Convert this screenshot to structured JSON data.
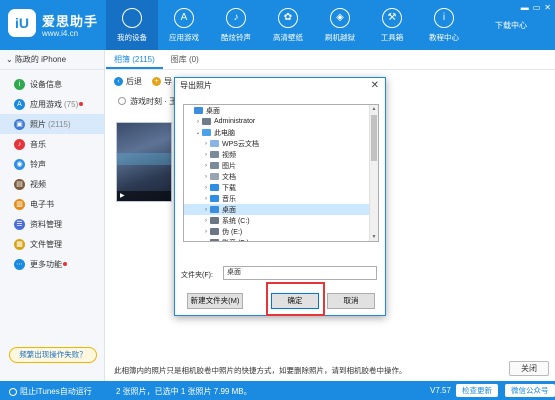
{
  "app": {
    "brand_name": "爱思助手",
    "brand_url": "www.i4.cn",
    "logo_text": "iU",
    "download_center": "下载中心",
    "window_controls": [
      "▬",
      "▭",
      "✕"
    ]
  },
  "nav": [
    {
      "label": "我的设备",
      "icon": "apple-icon",
      "glyph": "",
      "active": true
    },
    {
      "label": "应用游戏",
      "icon": "appstore-icon",
      "glyph": "A",
      "active": false
    },
    {
      "label": "酷炫铃声",
      "icon": "bell-icon",
      "glyph": "♪",
      "active": false
    },
    {
      "label": "高清壁纸",
      "icon": "flower-icon",
      "glyph": "✿",
      "active": false
    },
    {
      "label": "刷机越狱",
      "icon": "box-icon",
      "glyph": "◈",
      "active": false
    },
    {
      "label": "工具箱",
      "icon": "toolbox-icon",
      "glyph": "⚒",
      "active": false
    },
    {
      "label": "教程中心",
      "icon": "info-icon",
      "glyph": "i",
      "active": false
    }
  ],
  "sidebar": {
    "device": "陈政的 iPhone",
    "items": [
      {
        "label": "设备信息",
        "count": "",
        "dot": false,
        "active": false,
        "color": "#2fa84f",
        "glyph": "i"
      },
      {
        "label": "应用游戏",
        "count": "(75)",
        "dot": true,
        "active": false,
        "color": "#1a8be0",
        "glyph": "A"
      },
      {
        "label": "照片",
        "count": "(2115)",
        "dot": false,
        "active": true,
        "color": "#3e7bd6",
        "glyph": "▣"
      },
      {
        "label": "音乐",
        "count": "",
        "dot": false,
        "active": false,
        "color": "#e5353b",
        "glyph": "♪"
      },
      {
        "label": "铃声",
        "count": "",
        "dot": false,
        "active": false,
        "color": "#2f8fe6",
        "glyph": "◉"
      },
      {
        "label": "视频",
        "count": "",
        "dot": false,
        "active": false,
        "color": "#7a5b3a",
        "glyph": "▤"
      },
      {
        "label": "电子书",
        "count": "",
        "dot": false,
        "active": false,
        "color": "#e48b18",
        "glyph": "▥"
      },
      {
        "label": "资料管理",
        "count": "",
        "dot": false,
        "active": false,
        "color": "#4b6bd8",
        "glyph": "☰"
      },
      {
        "label": "文件管理",
        "count": "",
        "dot": false,
        "active": false,
        "color": "#d6a416",
        "glyph": "▦"
      },
      {
        "label": "更多功能",
        "count": "",
        "dot": true,
        "active": false,
        "color": "#1a8be0",
        "glyph": "⋯"
      }
    ],
    "feedback": "频繁出现操作失败？"
  },
  "main": {
    "tabs": [
      {
        "label": "相簿 (2115)",
        "active": true
      },
      {
        "label": "图库 (0)",
        "active": false
      }
    ],
    "toolbar": {
      "back": "后退",
      "import": "导"
    },
    "album": "游戏时刻 · 王者荣",
    "thumb_text": "▶",
    "notice": "此相簿内的照片只是相机胶卷中照片的快捷方式，如要删除照片，请到相机胶卷中操作。",
    "close": "关闭"
  },
  "status": {
    "itunes": "阻止iTunes自动运行",
    "counts": "2 张照片，已选中 1 张照片 7.99 MB。",
    "version": "V7.57",
    "check_update": "检查更新",
    "wechat": "微信公众号"
  },
  "dialog": {
    "title": "导出照片",
    "close": "✕",
    "tree": [
      {
        "label": "桌面",
        "indent": 0,
        "chev": "",
        "icon": "desktop-icon",
        "color": "#3b8de0",
        "selected": false
      },
      {
        "label": "Administrator",
        "indent": 1,
        "chev": "›",
        "icon": "user-icon",
        "color": "#6d7d8b",
        "selected": false
      },
      {
        "label": "此电脑",
        "indent": 1,
        "chev": "⌄",
        "icon": "computer-icon",
        "color": "#4aa3e8",
        "selected": false
      },
      {
        "label": "WPS云文档",
        "indent": 2,
        "chev": "›",
        "icon": "cloud-icon",
        "color": "#8ab4e8",
        "selected": false
      },
      {
        "label": "视频",
        "indent": 2,
        "chev": "›",
        "icon": "video-folder-icon",
        "color": "#7b8a99",
        "selected": false
      },
      {
        "label": "图片",
        "indent": 2,
        "chev": "›",
        "icon": "picture-folder-icon",
        "color": "#7b8a99",
        "selected": false
      },
      {
        "label": "文档",
        "indent": 2,
        "chev": "›",
        "icon": "document-folder-icon",
        "color": "#9aa5b1",
        "selected": false
      },
      {
        "label": "下载",
        "indent": 2,
        "chev": "›",
        "icon": "download-folder-icon",
        "color": "#2f8fe6",
        "selected": false
      },
      {
        "label": "音乐",
        "indent": 2,
        "chev": "›",
        "icon": "music-folder-icon",
        "color": "#2f8fe6",
        "selected": false
      },
      {
        "label": "桌面",
        "indent": 2,
        "chev": "›",
        "icon": "desktop-folder-icon",
        "color": "#3b8de0",
        "selected": true
      },
      {
        "label": "系统 (C:)",
        "indent": 2,
        "chev": "›",
        "icon": "drive-icon",
        "color": "#6b7785",
        "selected": false
      },
      {
        "label": "伪 (E:)",
        "indent": 2,
        "chev": "›",
        "icon": "drive-icon",
        "color": "#6b7785",
        "selected": false
      },
      {
        "label": "影音 (F:)",
        "indent": 2,
        "chev": "›",
        "icon": "drive-icon",
        "color": "#6b7785",
        "selected": false
      }
    ],
    "folder_label": "文件夹(F):",
    "folder_value": "桌面",
    "new_folder": "新建文件夹(M)",
    "ok": "确定",
    "cancel": "取消"
  },
  "colors": {
    "brand": "#1a8be0",
    "highlight": "#e5353b"
  }
}
